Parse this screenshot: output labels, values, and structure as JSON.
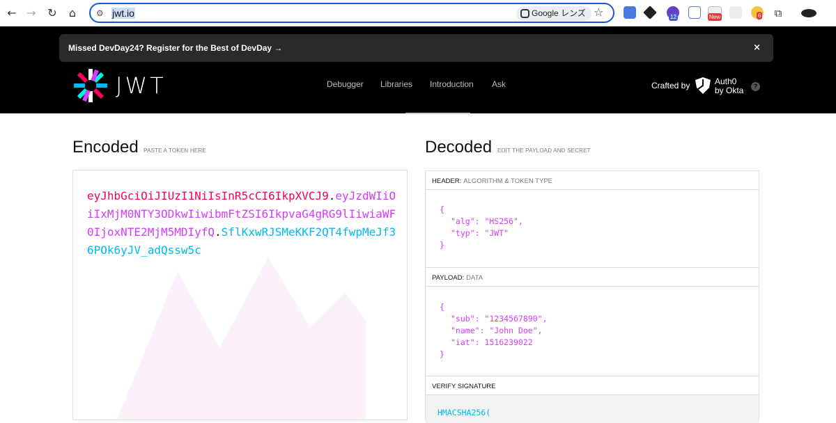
{
  "browser": {
    "url": "jwt.io",
    "lens_label": "Google レンズ",
    "ext_badges": [
      "12",
      "New",
      "6"
    ]
  },
  "banner": {
    "text": "Missed DevDay24? Register for the Best of DevDay →",
    "close": "×"
  },
  "header": {
    "logo_text": "JWT",
    "nav": [
      "Debugger",
      "Libraries",
      "Introduction",
      "Ask"
    ],
    "crafted_by": "Crafted by",
    "auth0_line1": "Auth0",
    "auth0_line2": "by Okta",
    "help": "?"
  },
  "encoded": {
    "title": "Encoded",
    "subtitle": "PASTE A TOKEN HERE",
    "header_part": "eyJhbGciOiJIUzI1NiIsInR5cCI6IkpXVCJ9",
    "payload_part": "eyJzdWIiOiIxMjM0NTY3ODkwIiwibmFtZSI6IkpvaG4gRG9lIiwiaWF0IjoxNTE2MjM5MDIyfQ",
    "signature_part": "SflKxwRJSMeKKF2QT4fwpMeJf36POk6yJV_adQssw5c",
    "dot": "."
  },
  "decoded": {
    "title": "Decoded",
    "subtitle": "EDIT THE PAYLOAD AND SECRET",
    "header_label": "HEADER:",
    "header_sub": "ALGORITHM & TOKEN TYPE",
    "header_json": {
      "open": "{",
      "line1": "\"alg\": \"HS256\",",
      "line2": "\"typ\": \"JWT\"",
      "close": "}"
    },
    "payload_label": "PAYLOAD:",
    "payload_sub": "DATA",
    "payload_json": {
      "open": "{",
      "line1": "\"sub\": \"1234567890\",",
      "line2": "\"name\": \"John Doe\",",
      "line3": "\"iat\": 1516239022",
      "close": "}"
    },
    "verify_label": "VERIFY SIGNATURE",
    "verify_code": "HMACSHA256("
  },
  "colors": {
    "token_header": "#fb015b",
    "token_payload": "#d63aff",
    "token_signature": "#00b9f1"
  }
}
